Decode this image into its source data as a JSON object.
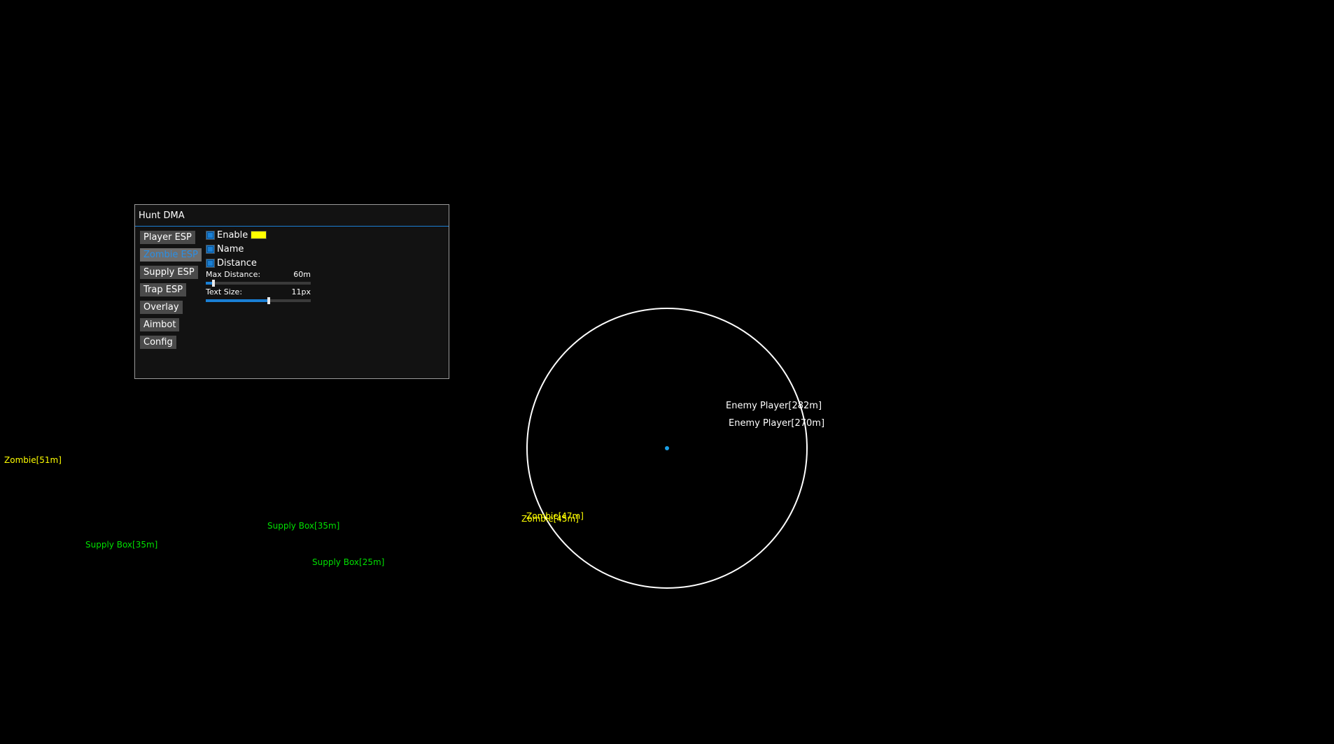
{
  "menu": {
    "title": "Hunt DMA",
    "tabs": [
      {
        "label": "Player ESP",
        "active": false
      },
      {
        "label": "Zombie ESP",
        "active": true
      },
      {
        "label": "Supply ESP",
        "active": false
      },
      {
        "label": "Trap ESP",
        "active": false
      },
      {
        "label": "Overlay",
        "active": false
      },
      {
        "label": "Aimbot",
        "active": false
      },
      {
        "label": "Config",
        "active": false
      }
    ],
    "options": {
      "enable_label": "Enable",
      "enable_checked": true,
      "enable_color": "#ffff00",
      "name_label": "Name",
      "name_checked": true,
      "distance_label": "Distance",
      "distance_checked": true
    },
    "sliders": {
      "max_distance_label": "Max Distance:",
      "max_distance_value": "60m",
      "max_distance_fraction": 0.07,
      "text_size_label": "Text Size:",
      "text_size_value": "11px",
      "text_size_fraction": 0.6
    }
  },
  "overlay": {
    "labels": {
      "zombie_1": "Zombie[51m]",
      "zombie_2": "Zombie[47m]",
      "zombie_3": "Zombie[45m]",
      "supply_1": "Supply Box[35m]",
      "supply_2": "Supply Box[35m]",
      "supply_3": "Supply Box[25m]",
      "enemy_1": "Enemy Player[282m]",
      "enemy_2": "Enemy Player[270m]"
    },
    "colors": {
      "zombie": "#ffff00",
      "supply": "#00e000",
      "enemy": "#ffffff",
      "fov_circle": "#ffffff",
      "crosshair": "#1a9fe6",
      "accent": "#1a7fd4"
    }
  }
}
